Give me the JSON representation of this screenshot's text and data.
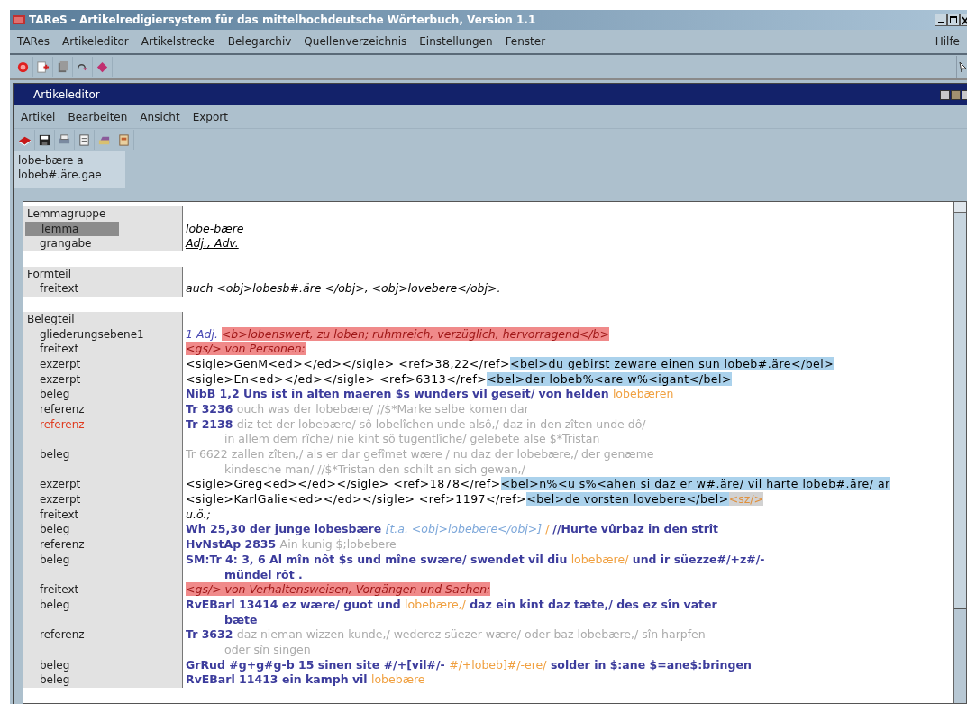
{
  "window": {
    "title": "TAReS - Artikelredigiersystem für das mittelhochdeutsche Wörterbuch, Version 1.1"
  },
  "menu": [
    "TARes",
    "Artikeleditor",
    "Artikelstrecke",
    "Belegarchiv",
    "Quellenverzeichnis",
    "Einstellungen",
    "Fenster"
  ],
  "help_menu": "Hilfe",
  "child_window": {
    "title": "Artikeleditor",
    "menu": [
      "Artikel",
      "Bearbeiten",
      "Ansicht",
      "Export"
    ],
    "tabs": [
      {
        "lines": [
          "lobe-bære a",
          "lobeb#.äre.gae"
        ],
        "selected": true
      }
    ],
    "rows": [
      {
        "kind": "group",
        "label": "Lemmagruppe"
      },
      {
        "kind": "field",
        "label": "lemma",
        "selected": true,
        "flagged": false,
        "lines": [
          [
            {
              "kind": "italic",
              "text": "lobe-bære"
            }
          ]
        ]
      },
      {
        "kind": "field",
        "label": "grangabe",
        "selected": false,
        "flagged": false,
        "lines": [
          [
            {
              "kind": "underlined",
              "text": "Adj., Adv."
            }
          ]
        ]
      },
      {
        "kind": "blank"
      },
      {
        "kind": "group",
        "label": "Formteil"
      },
      {
        "kind": "field",
        "label": "freitext",
        "selected": false,
        "flagged": false,
        "lines": [
          [
            {
              "kind": "italic",
              "text": "auch <obj>lobesb#.äre </obj>, <obj>lovebere</obj>."
            }
          ]
        ]
      },
      {
        "kind": "blank"
      },
      {
        "kind": "group",
        "label": "Belegteil"
      },
      {
        "kind": "field",
        "label": "gliederungsebene1",
        "selected": false,
        "flagged": false,
        "lines": [
          [
            {
              "kind": "number",
              "text": "1 Adj. "
            },
            {
              "kind": "meaning",
              "text": "<b>lobenswert, zu loben; ruhmreich, verzüglich, hervorragend</b>"
            }
          ]
        ]
      },
      {
        "kind": "field",
        "label": "freitext",
        "selected": false,
        "flagged": false,
        "lines": [
          [
            {
              "kind": "meaning",
              "text": "<gs/> von Personen:"
            }
          ]
        ]
      },
      {
        "kind": "field",
        "label": "exzerpt",
        "selected": false,
        "flagged": false,
        "lines": [
          [
            {
              "kind": "tag",
              "text": "<sigle>GenM<ed></ed></sigle> <ref>38,22</ref>"
            },
            {
              "kind": "quote",
              "text": "<bel>du gebirst zeware einen sun lobeb#.äre</bel>"
            }
          ]
        ]
      },
      {
        "kind": "field",
        "label": "exzerpt",
        "selected": false,
        "flagged": false,
        "lines": [
          [
            {
              "kind": "tag",
              "text": "<sigle>En<ed></ed></sigle> <ref>6313</ref>"
            },
            {
              "kind": "quote",
              "text": "<bel>der lobeb%<are w%<igant</bel>"
            }
          ]
        ]
      },
      {
        "kind": "field",
        "label": "beleg",
        "selected": false,
        "flagged": false,
        "lines": [
          [
            {
              "kind": "ref",
              "text": "NibB 1,2 Uns ist in alten maeren $s wunders vil geseit/ von helden "
            },
            {
              "kind": "keyword",
              "text": "lobebæren"
            }
          ]
        ]
      },
      {
        "kind": "field",
        "label": "referenz",
        "selected": false,
        "flagged": false,
        "lines": [
          [
            {
              "kind": "ref",
              "text": "Tr 3236 "
            },
            {
              "kind": "context",
              "text": "ouch was der lobebære/ //$*Marke selbe komen dar"
            }
          ]
        ]
      },
      {
        "kind": "field",
        "label": "referenz",
        "selected": false,
        "flagged": true,
        "lines": [
          [
            {
              "kind": "ref",
              "text": "Tr 2138 "
            },
            {
              "kind": "context",
              "text": "diz tet der lobebære/ sô lobelîchen unde alsô,/ daz in den zîten unde dô/"
            }
          ],
          [
            {
              "kind": "context",
              "text": "in allem dem rîche/ nie kint sô tugentlîche/ gelebete alse $*Tristan"
            }
          ]
        ]
      },
      {
        "kind": "field",
        "label": "beleg",
        "selected": false,
        "flagged": false,
        "lines": [
          [
            {
              "kind": "context",
              "text": "Tr 6622 zallen zîten,/ als er dar gefîmet wære / nu daz der lobebære,/ der genæme"
            }
          ],
          [
            {
              "kind": "context",
              "text": "kindesche man/ //$*Tristan den schilt an sich gewan,/"
            }
          ]
        ]
      },
      {
        "kind": "field",
        "label": "exzerpt",
        "selected": false,
        "flagged": false,
        "lines": [
          [
            {
              "kind": "tag",
              "text": "<sigle>Greg<ed></ed></sigle> <ref>1878</ref>"
            },
            {
              "kind": "quote",
              "text": "<bel>n%<u s%<ahen si daz er w#.äre/ vil harte lobeb#.äre/ ar"
            }
          ]
        ]
      },
      {
        "kind": "field",
        "label": "exzerpt",
        "selected": false,
        "flagged": false,
        "lines": [
          [
            {
              "kind": "tag",
              "text": "<sigle>KarlGalie<ed></ed></sigle> <ref>1197</ref>"
            },
            {
              "kind": "quote",
              "text": "<bel>de vorsten lovebere</bel>"
            },
            {
              "kind": "empty_tag",
              "text": "<sz/>"
            }
          ]
        ]
      },
      {
        "kind": "field",
        "label": "freitext",
        "selected": false,
        "flagged": false,
        "lines": [
          [
            {
              "kind": "italic",
              "text": "u.ö.;"
            }
          ]
        ]
      },
      {
        "kind": "field",
        "label": "beleg",
        "selected": false,
        "flagged": false,
        "lines": [
          [
            {
              "kind": "ref",
              "text": "Wh 25,30 der junge lobesbære "
            },
            {
              "kind": "variant",
              "text": "[t.a. <obj>lobebere</obj>]"
            },
            {
              "kind": "keyword",
              "text": " / "
            },
            {
              "kind": "ref",
              "text": "//Hurte vûrbaz in den strît"
            }
          ]
        ]
      },
      {
        "kind": "field",
        "label": "referenz",
        "selected": false,
        "flagged": false,
        "lines": [
          [
            {
              "kind": "ref",
              "text": "HvNstAp 2835 "
            },
            {
              "kind": "context",
              "text": "Ain kunig $;lobebere"
            }
          ]
        ]
      },
      {
        "kind": "field",
        "label": "beleg",
        "selected": false,
        "flagged": false,
        "lines": [
          [
            {
              "kind": "ref",
              "text": "SM:Tr 4: 3, 6 Al mîn nôt $s und mîne swære/ swendet vil diu "
            },
            {
              "kind": "keyword",
              "text": "lobebære/"
            },
            {
              "kind": "ref",
              "text": " und ir süezze#/+z#/-"
            }
          ],
          [
            {
              "kind": "ref",
              "text": "mündel rôt ."
            }
          ]
        ]
      },
      {
        "kind": "field",
        "label": "freitext",
        "selected": false,
        "flagged": false,
        "lines": [
          [
            {
              "kind": "meaning",
              "text": "<gs/> von Verhaltensweisen, Vorgängen und Sachen:"
            }
          ]
        ]
      },
      {
        "kind": "field",
        "label": "beleg",
        "selected": false,
        "flagged": false,
        "lines": [
          [
            {
              "kind": "ref",
              "text": "RvEBarl 13414 ez wære/ guot und "
            },
            {
              "kind": "keyword",
              "text": "lobebære,/"
            },
            {
              "kind": "ref",
              "text": " daz ein kint daz tæte,/ des ez sîn vater"
            }
          ],
          [
            {
              "kind": "ref",
              "text": "bæte"
            }
          ]
        ]
      },
      {
        "kind": "field",
        "label": "referenz",
        "selected": false,
        "flagged": false,
        "lines": [
          [
            {
              "kind": "ref",
              "text": "Tr 3632 "
            },
            {
              "kind": "context",
              "text": "daz nieman wizzen kunde,/ wederez süezer wære/ oder baz lobebære,/ sîn harpfen"
            }
          ],
          [
            {
              "kind": "context",
              "text": "oder sîn singen"
            }
          ]
        ]
      },
      {
        "kind": "field",
        "label": "beleg",
        "selected": false,
        "flagged": false,
        "lines": [
          [
            {
              "kind": "ref",
              "text": "GrRud #g+g#g-b 15 sinen site #/+[vil#/- "
            },
            {
              "kind": "keyword",
              "text": "#/+lobeb]#/-ere/"
            },
            {
              "kind": "ref",
              "text": " solder in $:ane $=ane$:bringen"
            }
          ]
        ]
      },
      {
        "kind": "field",
        "label": "beleg",
        "selected": false,
        "flagged": false,
        "lines": [
          [
            {
              "kind": "ref",
              "text": "RvEBarl 11413 ein kamph vil "
            },
            {
              "kind": "keyword",
              "text": "lobebære"
            }
          ]
        ]
      }
    ]
  }
}
